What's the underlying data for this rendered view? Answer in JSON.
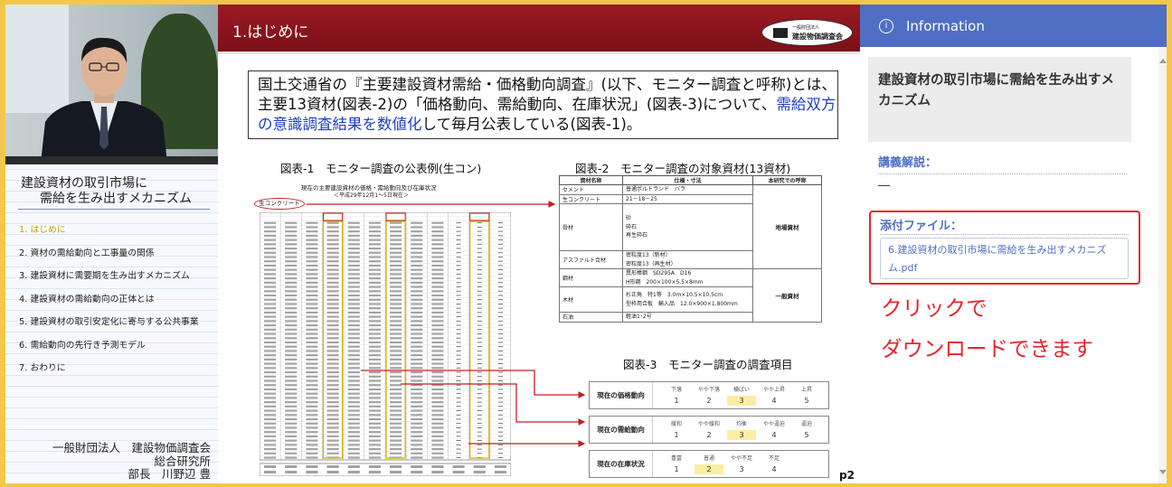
{
  "lesson": {
    "title_line1": "建設資材の取引市場に",
    "title_line2": "需給を生み出すメカニズム",
    "chapters": [
      "1. はじめに",
      "2. 資材の需給動向と工事量の関係",
      "3. 建設資材に需要期を生み出すメカニズム",
      "4. 建設資材の需給動向の正体とは",
      "5. 建設資材の取引安定化に寄与する公共事業",
      "6. 需給動向の先行き予測モデル",
      "7. おわりに"
    ],
    "active_index": 0,
    "org_line1": "一般財団法人　建設物価調査会",
    "org_line2": "総合研究所",
    "org_line3": "部長　川野辺 豊"
  },
  "slide": {
    "title": "1.はじめに",
    "logo_small": "一般財団法人",
    "logo_name": "建設物価調査会",
    "intro_part1": "国土交通省の『主要建設資材需給・価格動向調査』(以下、モニター調査と呼称)とは、主要13資材(図表-2)の「価格動向、需給動向、在庫状況」(図表-3)について、",
    "intro_blue": "需給双方の意識調査結果を数値化",
    "intro_part2": "して毎月公表している(図表-1)。",
    "fig1_title": "図表-1　モニター調査の公表例(生コン)",
    "fig1_subtitle": "現在の主要建設資材の価格・需給動向及び在庫状況",
    "fig1_subnote": "＜平成29年12月1～5日現在＞",
    "fig1_tag": "生コンクリート",
    "fig2_title": "図表-2　モニター調査の対象資材(13資材)",
    "fig2_headers": [
      "資材名称",
      "仕様・寸法",
      "本研究での呼称"
    ],
    "fig2_rows": [
      {
        "name": "セメント",
        "spec": "普通ポルトランド　バラ"
      },
      {
        "name": "生コンクリート",
        "spec": "21－18－25"
      },
      {
        "name": "骨材",
        "spec": "砂\n砕石\n再生砕石"
      },
      {
        "name": "アスファルト合材",
        "spec": "密粒度13（新材）\n密粒度13（再生材）"
      },
      {
        "name": "鋼材",
        "spec": "異形棒鋼　SD295A　D16\nH形鋼　200×100×5.5×8mm"
      },
      {
        "name": "木材",
        "spec": "杉正角　特1等　3.0m×10.5×10.5cm\n型枠用合板　輸入品　12.0×900×1,800mm"
      },
      {
        "name": "石油",
        "spec": "軽油1･2号"
      }
    ],
    "fig2_class_local": "地場資材",
    "fig2_class_general": "一般資材",
    "fig3_title": "図表-3　モニター調査の調査項目",
    "fig3_rows": [
      {
        "label": "現在の価格動向",
        "options": [
          "下落",
          "やや下落",
          "横ばい",
          "やや上昇",
          "上昇"
        ],
        "numbers": [
          "1",
          "2",
          "3",
          "4",
          "5"
        ],
        "selected": 2
      },
      {
        "label": "現在の需給動向",
        "options": [
          "緩和",
          "やや緩和",
          "均衡",
          "やや逼迫",
          "逼迫"
        ],
        "numbers": [
          "1",
          "2",
          "3",
          "4",
          "5"
        ],
        "selected": 2
      },
      {
        "label": "現在の在庫状況",
        "options": [
          "豊富",
          "普通",
          "やや不足",
          "不足"
        ],
        "numbers": [
          "1",
          "2",
          "3",
          "4"
        ],
        "selected": 1
      }
    ],
    "page": "p2"
  },
  "info": {
    "header_title": "Information",
    "lecture_title": "建設資材の取引市場に需給を生み出すメカニズム",
    "commentary_label": "講義解説：",
    "commentary_value": "―",
    "attachment_label": "添付ファイル：",
    "attachment_file": "6.建設資材の取引市場に需給を生み出すメカニズム.pdf",
    "note_line1": "クリックで",
    "note_line2": "ダウンロードできます"
  },
  "colors": {
    "frame": "#f3c84a",
    "slide_header": "#8a1520",
    "info_header": "#4f6fc4",
    "accent_red": "#e8262b",
    "active_chapter": "#c99c00"
  },
  "icons": [
    "info-icon",
    "scroll-up-icon",
    "scroll-down-icon",
    "arrow-icon"
  ]
}
